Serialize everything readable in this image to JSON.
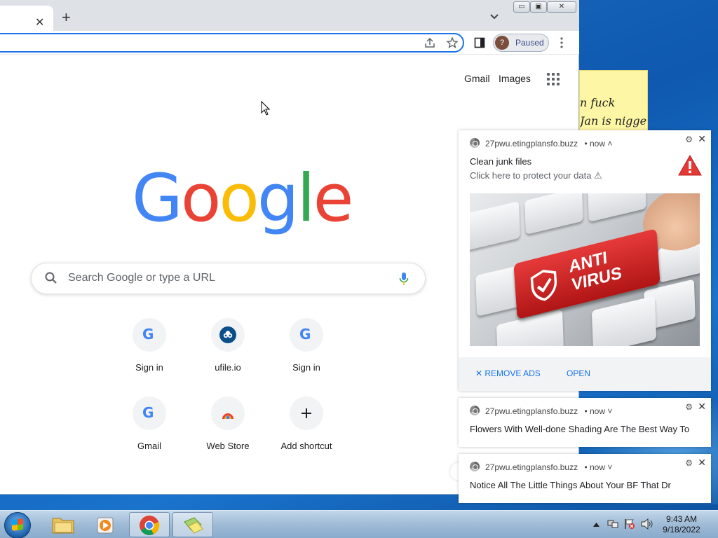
{
  "browser": {
    "tab_close": "✕",
    "new_tab": "+",
    "profile_initial": "?",
    "profile_status": "Paused",
    "window_buttons": {
      "minimize": "▭",
      "maximize": "▣",
      "close": "✕"
    }
  },
  "google": {
    "logo_letters": [
      "G",
      "o",
      "o",
      "g",
      "l",
      "e"
    ],
    "logo_colors": [
      "#4285f4",
      "#ea4335",
      "#fbbc05",
      "#4285f4",
      "#34a853",
      "#ea4335"
    ],
    "top_links": [
      "Gmail",
      "Images"
    ],
    "search_placeholder": "Search Google or type a URL",
    "shortcuts": [
      {
        "label": "Sign in",
        "icon": "google-g-icon"
      },
      {
        "label": "ufile.io",
        "icon": "ufile-icon"
      },
      {
        "label": "Sign in",
        "icon": "google-g-icon"
      },
      {
        "label": "Gmail",
        "icon": "google-g-icon"
      },
      {
        "label": "Web Store",
        "icon": "web-store-icon"
      },
      {
        "label": "Add shortcut",
        "icon": "plus-icon"
      }
    ]
  },
  "sticky_note": {
    "lines": [
      "n fuck",
      "Jan is nigger"
    ]
  },
  "notifications": [
    {
      "source": "27pwu.etingplansfo.buzz",
      "time": "• now ˄",
      "title": "Clean junk files",
      "body": "Click here to protect your data ⚠",
      "image_text": [
        "ANTI",
        "VIRUS"
      ],
      "actions": [
        "✕ REMOVE ADS",
        "OPEN"
      ]
    },
    {
      "source": "27pwu.etingplansfo.buzz",
      "time": "• now ˅",
      "title": "Flowers With Well-done Shading Are The Best Way To"
    },
    {
      "source": "27pwu.etingplansfo.buzz",
      "time": "• now ˅",
      "title": "Notice All The Little Things About Your BF That Dr"
    }
  ],
  "taskbar": {
    "clock_time": "9:43 AM",
    "clock_date": "9/18/2022"
  },
  "colors": {
    "accent_blue": "#1a73e8",
    "warning_red": "#e53935"
  }
}
